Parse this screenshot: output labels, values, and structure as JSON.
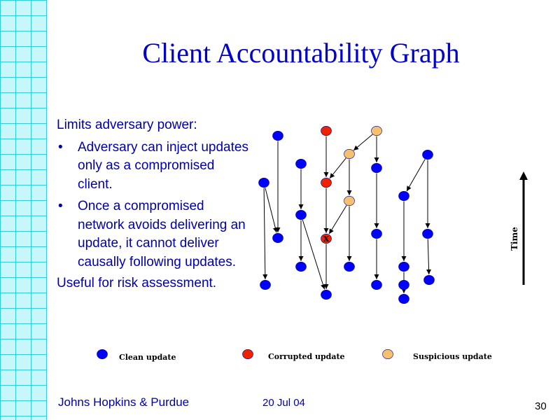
{
  "slide": {
    "title": "Client Accountability Graph",
    "intro": "Limits adversary power:",
    "bullets": [
      "Adversary can inject updates only as a compromised client.",
      "Once a compromised network avoids delivering an update, it cannot deliver causally following updates."
    ],
    "conclusion": "Useful for risk assessment.",
    "footer_left": "Johns Hopkins & Purdue",
    "footer_date": "20 Jul 04",
    "page_number": "30"
  },
  "diagram": {
    "time_label": "Time",
    "corrupted_mark": "X",
    "colors": {
      "clean": "#0000ff",
      "corrupted": "#ee2200",
      "suspicious": "#f5c070",
      "edge": "#000000"
    },
    "legend": [
      {
        "type": "clean",
        "label": "Clean update"
      },
      {
        "type": "corrupted",
        "label": "Corrupted update"
      },
      {
        "type": "suspicious",
        "label": "Suspicious update"
      }
    ],
    "node_types": [
      "clean",
      "clean",
      "clean",
      "clean",
      "clean",
      "clean",
      "clean",
      "corrupted",
      "corrupted",
      "clean",
      "suspicious",
      "suspicious",
      "suspicious",
      "clean",
      "clean",
      "clean",
      "clean",
      "clean",
      "clean",
      "clean",
      "clean",
      "clean",
      "clean",
      "clean"
    ],
    "edges": [
      [
        0,
        1
      ],
      [
        2,
        3
      ],
      [
        4,
        5
      ],
      [
        5,
        6
      ],
      [
        7,
        8
      ],
      [
        8,
        9
      ],
      [
        10,
        11
      ],
      [
        10,
        8
      ],
      [
        11,
        12
      ],
      [
        12,
        13
      ],
      [
        12,
        9
      ],
      [
        14,
        15
      ],
      [
        15,
        16
      ],
      [
        16,
        17
      ],
      [
        18,
        19
      ],
      [
        19,
        20
      ],
      [
        20,
        21
      ],
      [
        22,
        18
      ],
      [
        22,
        23
      ],
      [
        23,
        24
      ],
      [
        3,
        7
      ],
      [
        5,
        9
      ]
    ]
  }
}
